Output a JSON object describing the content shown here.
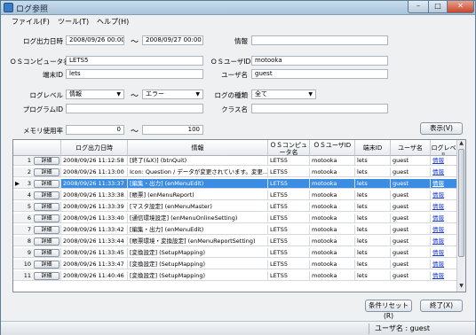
{
  "window": {
    "title": "ログ参照"
  },
  "titlebar_buttons": {
    "minimize": "–",
    "maximize": "□",
    "close": "✕"
  },
  "menu": [
    {
      "label": "ファイル(F)"
    },
    {
      "label": "ツール(T)"
    },
    {
      "label": "ヘルプ(H)"
    }
  ],
  "filters": {
    "log_datetime_label": "ログ出力日時",
    "datetime_from": "2008/09/26 00:00",
    "tilde": "～",
    "datetime_to": "2008/09/27 00:00",
    "info_label": "情報",
    "info_value": "",
    "os_computer_label": "ＯＳコンピュータ名",
    "os_computer_value": "LETS5",
    "os_user_label": "ＯＳユーザID",
    "os_user_value": "motooka",
    "terminal_label": "端末ID",
    "terminal_value": "lets",
    "username_label": "ユーザ名",
    "username_value": "guest",
    "loglevel_label": "ログレベル",
    "loglevel_from": "情報",
    "loglevel_to": "エラー",
    "logtype_label": "ログの種類",
    "logtype_value": "全て",
    "program_label": "プログラムID",
    "program_value": "",
    "class_label": "クラス名",
    "class_value": "",
    "memory_label": "メモリ使用率",
    "memory_from": "0",
    "memory_to": "100"
  },
  "buttons": {
    "display": "表示(V)",
    "reset": "条件リセット(R)",
    "exit": "終了(X)"
  },
  "grid": {
    "columns": [
      "",
      "ログ出力日時",
      "情報",
      "ＯＳコンピュータ名",
      "ＯＳユーザID",
      "端末ID",
      "ユーザ名",
      "ログレベル"
    ],
    "detail_label": "詳細",
    "selected_index": 2,
    "rows": [
      {
        "no": "1",
        "datetime": "2008/09/26 11:12:58",
        "info": "[終了(&X)] (btnQuit)",
        "computer": "LETS5",
        "user": "motooka",
        "terminal": "lets",
        "username": "guest",
        "level": "情報"
      },
      {
        "no": "2",
        "datetime": "2008/09/26 11:13:00",
        "info": "Icon: Question / データが変更されています。変更...",
        "computer": "LETS5",
        "user": "motooka",
        "terminal": "lets",
        "username": "guest",
        "level": "情報"
      },
      {
        "no": "3",
        "datetime": "2008/09/26 11:33:37",
        "info": "[編集・出力] (enMenuEdit)",
        "computer": "LETS5",
        "user": "motooka",
        "terminal": "lets",
        "username": "guest",
        "level": "情報"
      },
      {
        "no": "4",
        "datetime": "2008/09/26 11:33:38",
        "info": "[帳票] (enMenuReport)",
        "computer": "LETS5",
        "user": "motooka",
        "terminal": "lets",
        "username": "guest",
        "level": "情報"
      },
      {
        "no": "5",
        "datetime": "2008/09/26 11:33:39",
        "info": "[マスタ設定] (enMenuMaster)",
        "computer": "LETS5",
        "user": "motooka",
        "terminal": "lets",
        "username": "guest",
        "level": "情報"
      },
      {
        "no": "6",
        "datetime": "2008/09/26 11:33:40",
        "info": "[通信環境設定] (enMenuOnlineSetting)",
        "computer": "LETS5",
        "user": "motooka",
        "terminal": "lets",
        "username": "guest",
        "level": "情報"
      },
      {
        "no": "7",
        "datetime": "2008/09/26 11:33:42",
        "info": "[編集・出力] (enMenuEdit)",
        "computer": "LETS5",
        "user": "motooka",
        "terminal": "lets",
        "username": "guest",
        "level": "情報"
      },
      {
        "no": "8",
        "datetime": "2008/09/26 11:33:44",
        "info": "[帳票環境・変換設定] (enMenuReportSetting)",
        "computer": "LETS5",
        "user": "motooka",
        "terminal": "lets",
        "username": "guest",
        "level": "情報"
      },
      {
        "no": "9",
        "datetime": "2008/09/26 11:33:45",
        "info": "[変換設定] (SetupMapping)",
        "computer": "LETS5",
        "user": "motooka",
        "terminal": "lets",
        "username": "guest",
        "level": "情報"
      },
      {
        "no": "10",
        "datetime": "2008/09/26 11:33:47",
        "info": "[変換設定] (SetupMapping)",
        "computer": "LETS5",
        "user": "motooka",
        "terminal": "lets",
        "username": "guest",
        "level": "情報"
      },
      {
        "no": "11",
        "datetime": "2008/09/26 11:40:46",
        "info": "[変換設定] (SetupMapping)",
        "computer": "LETS5",
        "user": "motooka",
        "terminal": "lets",
        "username": "guest",
        "level": "情報"
      }
    ]
  },
  "status": {
    "text": "ユーザ名 : guest"
  }
}
